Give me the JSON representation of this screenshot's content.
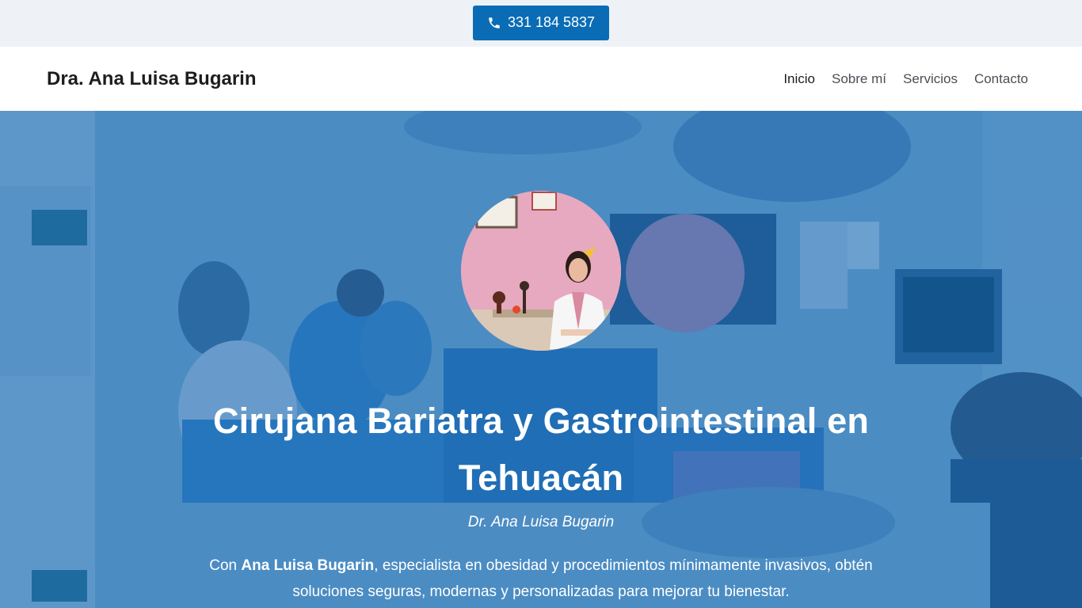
{
  "topbar": {
    "phone_icon": "phone-icon",
    "phone_label": "331 184 5837"
  },
  "header": {
    "brand": "Dra. Ana Luisa Bugarin",
    "nav": [
      {
        "label": "Inicio",
        "active": true
      },
      {
        "label": "Sobre mí",
        "active": false
      },
      {
        "label": "Servicios",
        "active": false
      },
      {
        "label": "Contacto",
        "active": false
      }
    ]
  },
  "hero": {
    "title": "Cirujana Bariatra y Gastrointestinal en Tehuacán",
    "subtitle": "Dr. Ana Luisa Bugarin",
    "desc_prefix": "Con ",
    "desc_bold": "Ana Luisa Bugarin",
    "desc_suffix": ", especialista en obesidad y procedimientos mínimamente invasivos, obtén soluciones seguras, modernas y personalizadas para mejorar tu bienestar.",
    "overlay_color": "#1469b4",
    "accent_color": "#0a6cb5"
  }
}
